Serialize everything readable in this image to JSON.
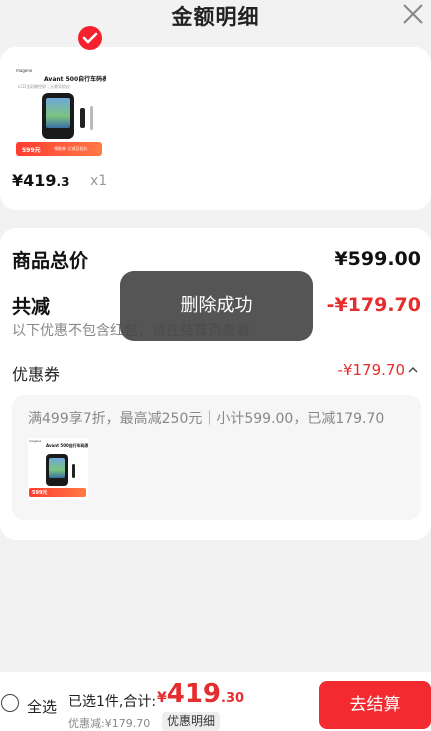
{
  "header": {
    "title": "金额明细",
    "close_icon": "close-icon"
  },
  "product": {
    "brand": "magene",
    "name": "Avant 500自行车码表",
    "subtitle": "LCD全彩触控屏 | 无需导航仪",
    "banner_price": "599元",
    "banner_text": "领取券 立减至低价",
    "price_int": "¥419",
    "price_dec": ".3",
    "qty": "x1",
    "selected_icon": "check-icon"
  },
  "summary": {
    "total_label": "商品总价",
    "total_value": "¥599.00",
    "discount_label": "共减",
    "discount_value": "-¥179.70",
    "note": "以下优惠不包含红包，请在结算页查看",
    "coupon_label": "优惠券",
    "coupon_value": "-¥179.70",
    "coupon_desc": "满499享7折，最高减250元｜小计599.00，已减179.70"
  },
  "toast": {
    "text": "删除成功"
  },
  "footer": {
    "select_all": "全选",
    "selected_summary": "已选1件,合计:",
    "currency": "¥",
    "total_int": "419",
    "total_dec": ".30",
    "saved": "优惠减:¥179.70",
    "detail_button": "优惠明细",
    "checkout_button": "去结算"
  },
  "colors": {
    "accent": "#f32a2f",
    "price_red": "#e62d2d",
    "background": "#f2f2f2"
  }
}
